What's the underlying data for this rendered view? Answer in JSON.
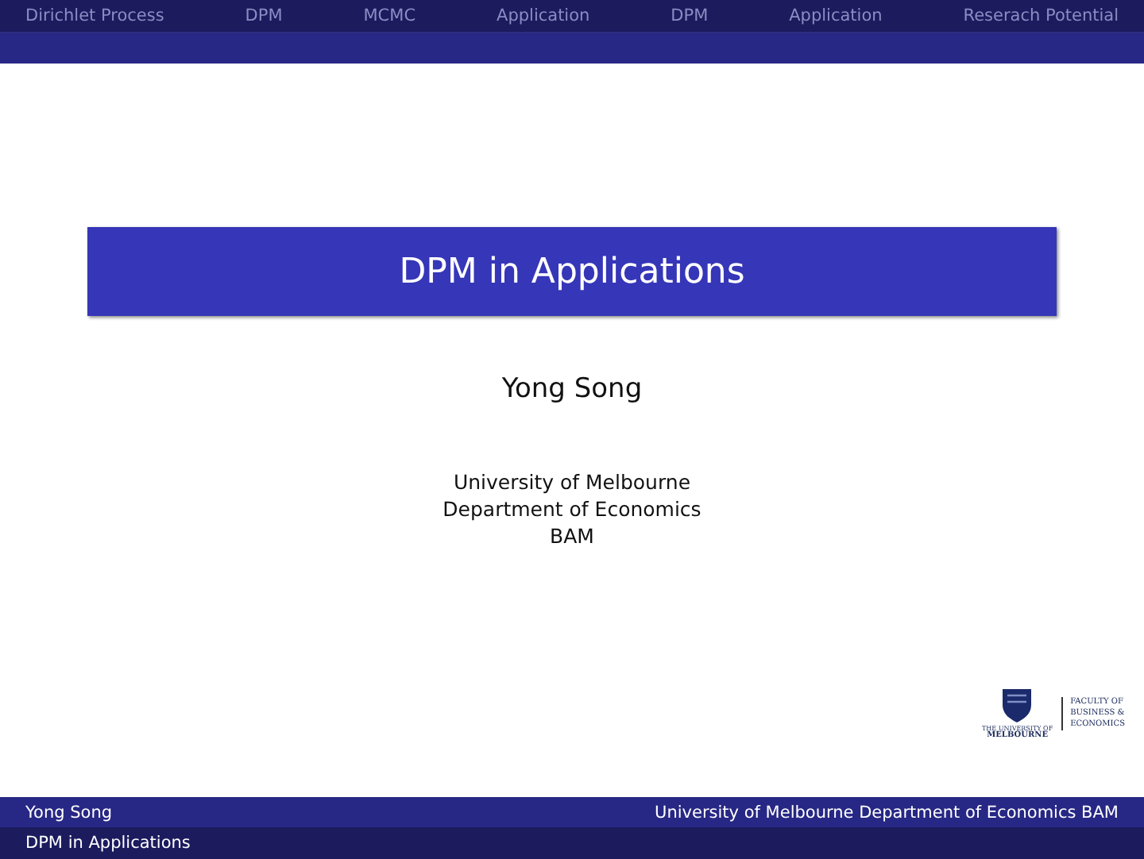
{
  "nav": {
    "sections": [
      {
        "label": "Dirichlet Process",
        "selected": false
      },
      {
        "label": "DPM",
        "selected": false
      },
      {
        "label": "MCMC",
        "selected": false
      },
      {
        "label": "Application",
        "selected": false
      },
      {
        "label": "DPM",
        "selected": false
      },
      {
        "label": "Application",
        "selected": false
      },
      {
        "label": "Reserach Potential",
        "selected": false
      }
    ]
  },
  "title": "DPM in Applications",
  "author": "Yong Song",
  "affiliation": [
    "University of Melbourne",
    "Department of Economics",
    "BAM"
  ],
  "logo": {
    "university": [
      "THE UNIVERSITY OF",
      "MELBOURNE"
    ],
    "faculty": [
      "FACULTY OF",
      "BUSINESS &",
      "ECONOMICS"
    ]
  },
  "footer": {
    "author": "Yong Song",
    "institute": "University of Melbourne Department of Economics BAM",
    "title": "DPM in Applications"
  }
}
